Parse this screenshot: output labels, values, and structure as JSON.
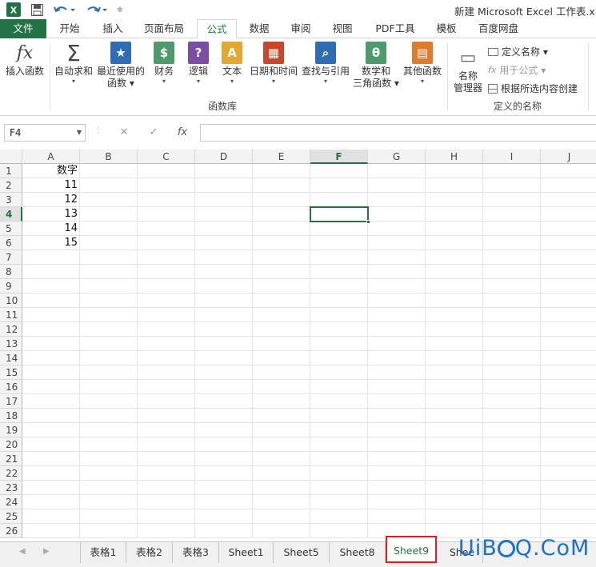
{
  "window": {
    "title": "新建 Microsoft Excel 工作表.xlsx"
  },
  "ribbon_tabs": [
    {
      "label": "文件"
    },
    {
      "label": "开始"
    },
    {
      "label": "插入"
    },
    {
      "label": "页面布局"
    },
    {
      "label": "公式"
    },
    {
      "label": "数据"
    },
    {
      "label": "审阅"
    },
    {
      "label": "视图"
    },
    {
      "label": "PDF工具"
    },
    {
      "label": "模板"
    },
    {
      "label": "百度网盘"
    }
  ],
  "ribbon": {
    "buttons": [
      {
        "line1": "插入函数",
        "line2": "",
        "icon": "fx",
        "color": "#555555"
      },
      {
        "line1": "自动求和",
        "line2": "▾",
        "icon": "Σ",
        "color": "#555555"
      },
      {
        "line1": "最近使用的",
        "line2": "函数 ▾",
        "icon": "★",
        "color": "#2e6db4"
      },
      {
        "line1": "财务",
        "line2": "▾",
        "icon": "$",
        "color": "#4f9a6b"
      },
      {
        "line1": "逻辑",
        "line2": "▾",
        "icon": "?",
        "color": "#7b4ea3"
      },
      {
        "line1": "文本",
        "line2": "▾",
        "icon": "A",
        "color": "#e3a833"
      },
      {
        "line1": "日期和时间",
        "line2": "▾",
        "icon": "▦",
        "color": "#c8462b"
      },
      {
        "line1": "查找与引用",
        "line2": "▾",
        "icon": "⌕",
        "color": "#2e6db4"
      },
      {
        "line1": "数学和",
        "line2": "三角函数 ▾",
        "icon": "θ",
        "color": "#4f9a6b"
      },
      {
        "line1": "其他函数",
        "line2": "▾",
        "icon": "▤",
        "color": "#e07b2c"
      },
      {
        "line1": "名称",
        "line2": "管理器",
        "icon": "▭",
        "color": "#8a8a8a"
      }
    ],
    "group_function_library": "函数库",
    "group_defined_names": "定义的名称",
    "define_name": "定义名称 ▾",
    "use_in_formula": "用于公式 ▾",
    "create_from_selection": "根据所选内容创建"
  },
  "formula_bar": {
    "name_box": "F4",
    "cancel": "✕",
    "enter": "✓",
    "fx": "fx",
    "content": ""
  },
  "columns": [
    "A",
    "B",
    "C",
    "D",
    "E",
    "F",
    "G",
    "H",
    "I",
    "J"
  ],
  "rows": [
    "1",
    "2",
    "3",
    "4",
    "5",
    "6",
    "7",
    "8",
    "9",
    "10",
    "11",
    "12",
    "13",
    "14",
    "15",
    "16",
    "17",
    "18",
    "19",
    "20",
    "21",
    "22",
    "23",
    "24",
    "25",
    "26"
  ],
  "active": {
    "column": "F",
    "row": "4"
  },
  "cells": {
    "A1": "数字",
    "A2": "11",
    "A3": "12",
    "A4": "13",
    "A5": "14",
    "A6": "15"
  },
  "sheet_tabs": [
    {
      "label": "表格1"
    },
    {
      "label": "表格2"
    },
    {
      "label": "表格3"
    },
    {
      "label": "Sheet1"
    },
    {
      "label": "Sheet5"
    },
    {
      "label": "Sheet8"
    },
    {
      "label": "Sheet9"
    },
    {
      "label": "Shee"
    }
  ],
  "active_sheet": "Sheet9",
  "watermark": {
    "left": "UiB",
    "right": "Q.CoM"
  },
  "colors": {
    "accent": "#217346",
    "highlight": "#e02020",
    "watermark": "#1a73c9"
  }
}
